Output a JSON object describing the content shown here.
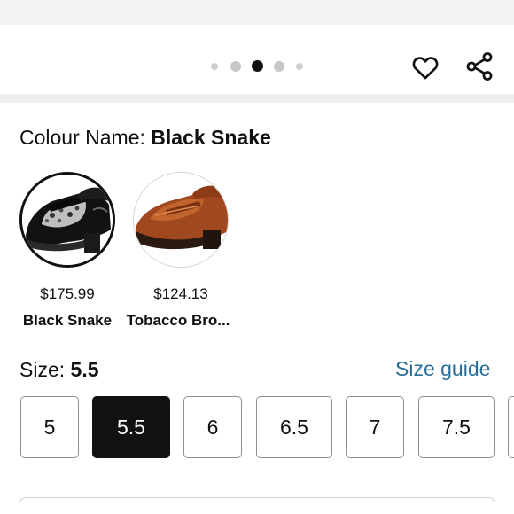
{
  "carousel": {
    "dot_count": 5,
    "active_index": 2
  },
  "actions": {
    "wishlist_icon": "heart-icon",
    "share_icon": "share-icon"
  },
  "colour": {
    "label": "Colour Name: ",
    "selected": "Black Snake",
    "options": [
      {
        "name": "Black Snake",
        "price": "$175.99",
        "selected": true
      },
      {
        "name": "Tobacco Bro...",
        "price": "$124.13",
        "selected": false
      }
    ]
  },
  "size": {
    "label": "Size: ",
    "selected": "5.5",
    "guide_label": "Size guide",
    "options": [
      "5",
      "5.5",
      "6",
      "6.5",
      "7",
      "7.5",
      ""
    ]
  },
  "colors": {
    "link": "#2a6f97",
    "selected_bg": "#111111",
    "border": "#8f8f8f"
  }
}
